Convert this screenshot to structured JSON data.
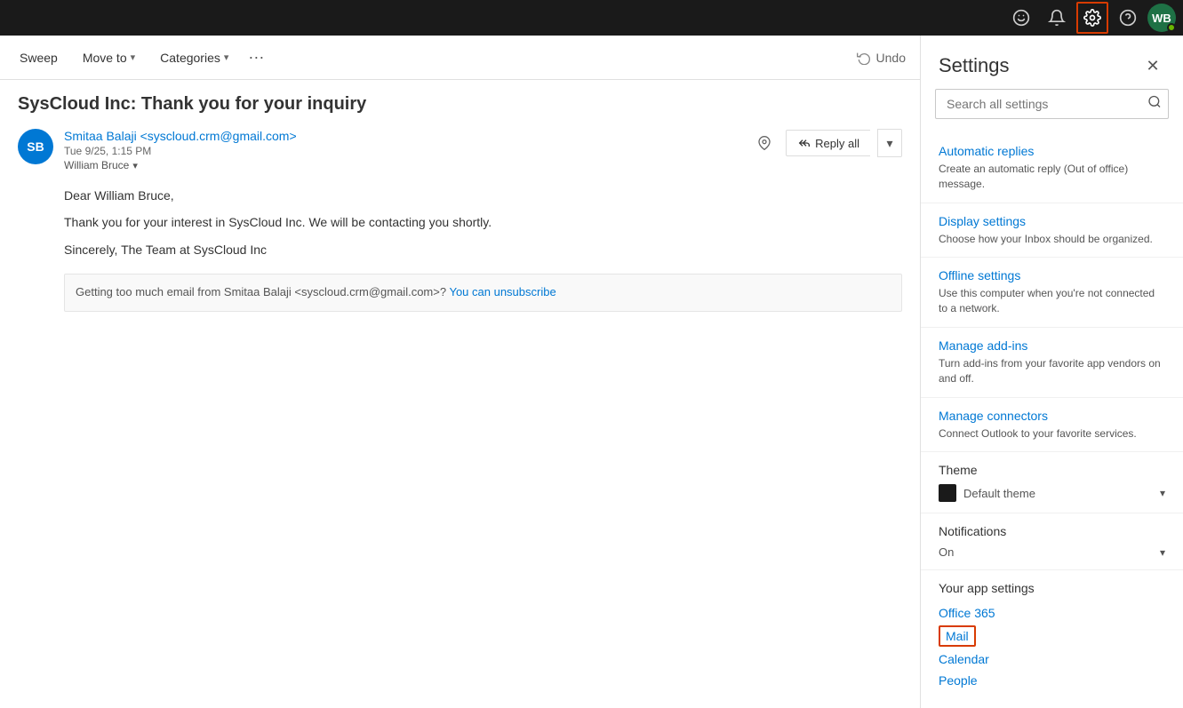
{
  "topbar": {
    "skype_icon": "💬",
    "bell_icon": "🔔",
    "gear_icon": "⚙",
    "help_icon": "?",
    "avatar_initials": "WB"
  },
  "toolbar": {
    "sweep_label": "Sweep",
    "move_to_label": "Move to",
    "categories_label": "Categories",
    "undo_label": "Undo"
  },
  "email": {
    "subject": "SysCloud Inc: Thank you for your inquiry",
    "sender_initials": "SB",
    "sender_name": "Smitaa Balaji <syscloud.crm@gmail.com>",
    "date": "Tue 9/25, 1:15 PM",
    "to": "William Bruce",
    "reply_all_label": "Reply all",
    "body_line1": "Dear William Bruce,",
    "body_line2": "Thank you for your interest in SysCloud Inc.  We will be contacting you shortly.",
    "body_line3": "Sincerely,  The Team at SysCloud Inc",
    "unsubscribe_text": "Getting too much email from Smitaa Balaji <syscloud.crm@gmail.com>?",
    "unsubscribe_link": "You can unsubscribe"
  },
  "settings": {
    "title": "Settings",
    "search_placeholder": "Search all settings",
    "close_icon": "✕",
    "items": [
      {
        "title": "Automatic replies",
        "desc": "Create an automatic reply (Out of office) message."
      },
      {
        "title": "Display settings",
        "desc": "Choose how your Inbox should be organized."
      },
      {
        "title": "Offline settings",
        "desc": "Use this computer when you're not connected to a network."
      },
      {
        "title": "Manage add-ins",
        "desc": "Turn add-ins from your favorite app vendors on and off."
      },
      {
        "title": "Manage connectors",
        "desc": "Connect Outlook to your favorite services."
      }
    ],
    "theme": {
      "section_title": "Theme",
      "value": "Default theme"
    },
    "notifications": {
      "section_title": "Notifications",
      "value": "On"
    },
    "your_app_settings": {
      "section_title": "Your app settings",
      "links": [
        "Office 365",
        "Mail",
        "Calendar",
        "People"
      ]
    }
  }
}
